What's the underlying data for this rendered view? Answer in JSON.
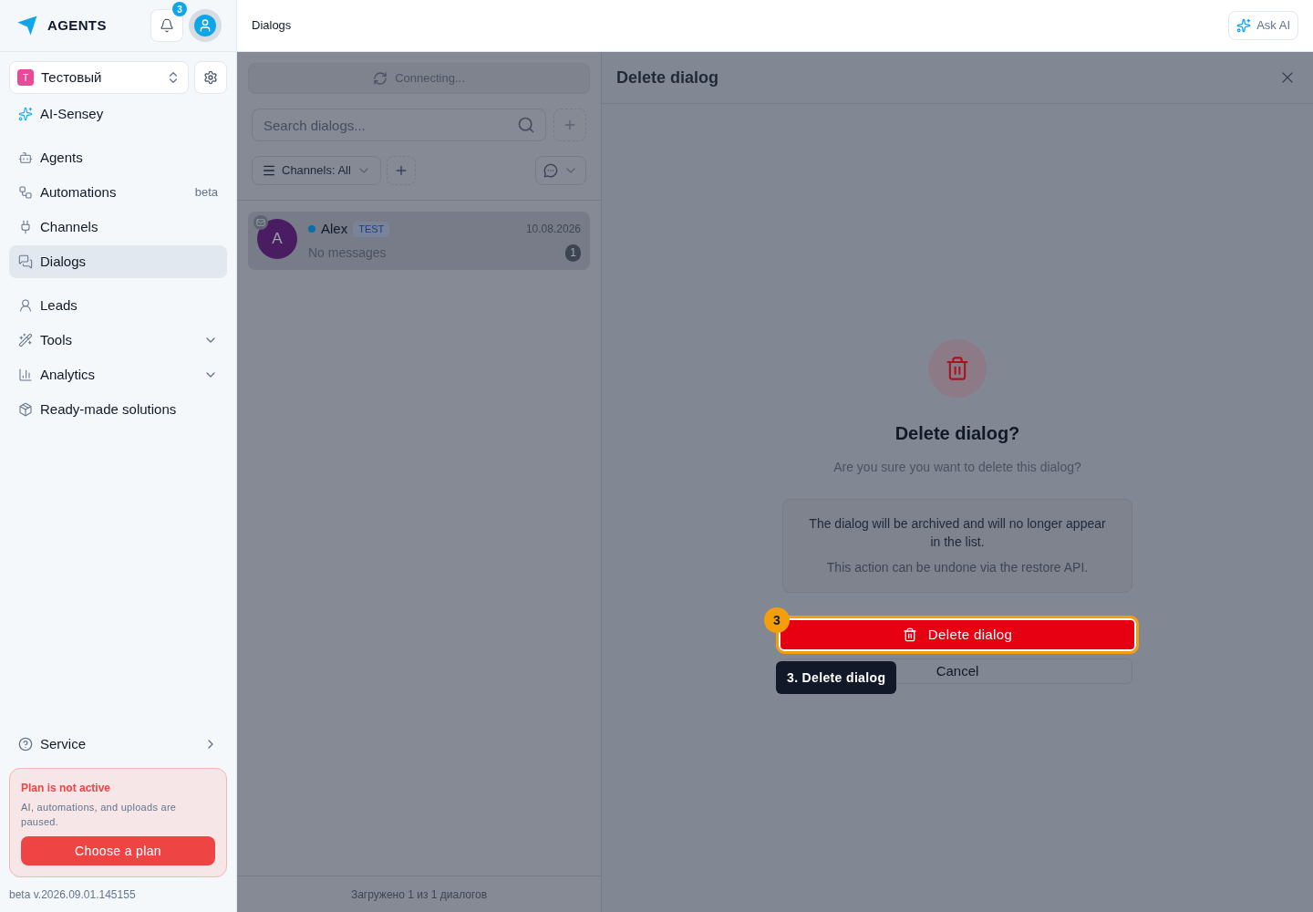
{
  "header": {
    "logo_text": "AGENTS",
    "notification_count": "3",
    "breadcrumb": "Dialogs",
    "ask_ai": "Ask AI"
  },
  "sidebar": {
    "workspace": {
      "initial": "T",
      "name": "Тестовый"
    },
    "sections": [
      {
        "items": [
          {
            "label": "AI-Sensey",
            "selected": false
          }
        ]
      },
      {
        "items": [
          {
            "label": "Agents",
            "selected": false
          },
          {
            "label": "Automations",
            "badge": "beta",
            "selected": false
          },
          {
            "label": "Channels",
            "selected": false
          },
          {
            "label": "Dialogs",
            "selected": true
          }
        ]
      },
      {
        "items": [
          {
            "label": "Leads",
            "selected": false
          },
          {
            "label": "Tools",
            "expanded": false,
            "selected": false
          },
          {
            "label": "Analytics",
            "expanded": false,
            "selected": false
          },
          {
            "label": "Ready-made solutions",
            "selected": false
          }
        ]
      }
    ],
    "service": {
      "label": "Service",
      "expanded": false
    },
    "plan": {
      "title": "Plan is not active",
      "text": "AI, automations, and uploads are paused.",
      "button": "Choose a plan"
    },
    "version": "beta v.2026.09.01.145155"
  },
  "dialogs": {
    "status": "Connecting...",
    "search": {
      "placeholder": "Search dialogs..."
    },
    "channel_filter": "Channels: All",
    "items": [
      {
        "initial": "A",
        "name": "Alex",
        "tag": "TEST",
        "date": "10.08.2026",
        "preview": "No messages",
        "unread": "1",
        "online": true,
        "selected": true
      }
    ],
    "footer": "Загружено 1 из 1 диалогов"
  },
  "modal": {
    "title": "Delete dialog",
    "heading": "Delete dialog?",
    "question": "Are you sure you want to delete this dialog?",
    "info": "The dialog will be archived and will no longer appear in the list.",
    "note": "This action can be undone via the restore API.",
    "delete_button": "Delete dialog",
    "cancel_button": "Cancel",
    "step": {
      "number": "3",
      "tooltip": "3. Delete dialog"
    }
  }
}
